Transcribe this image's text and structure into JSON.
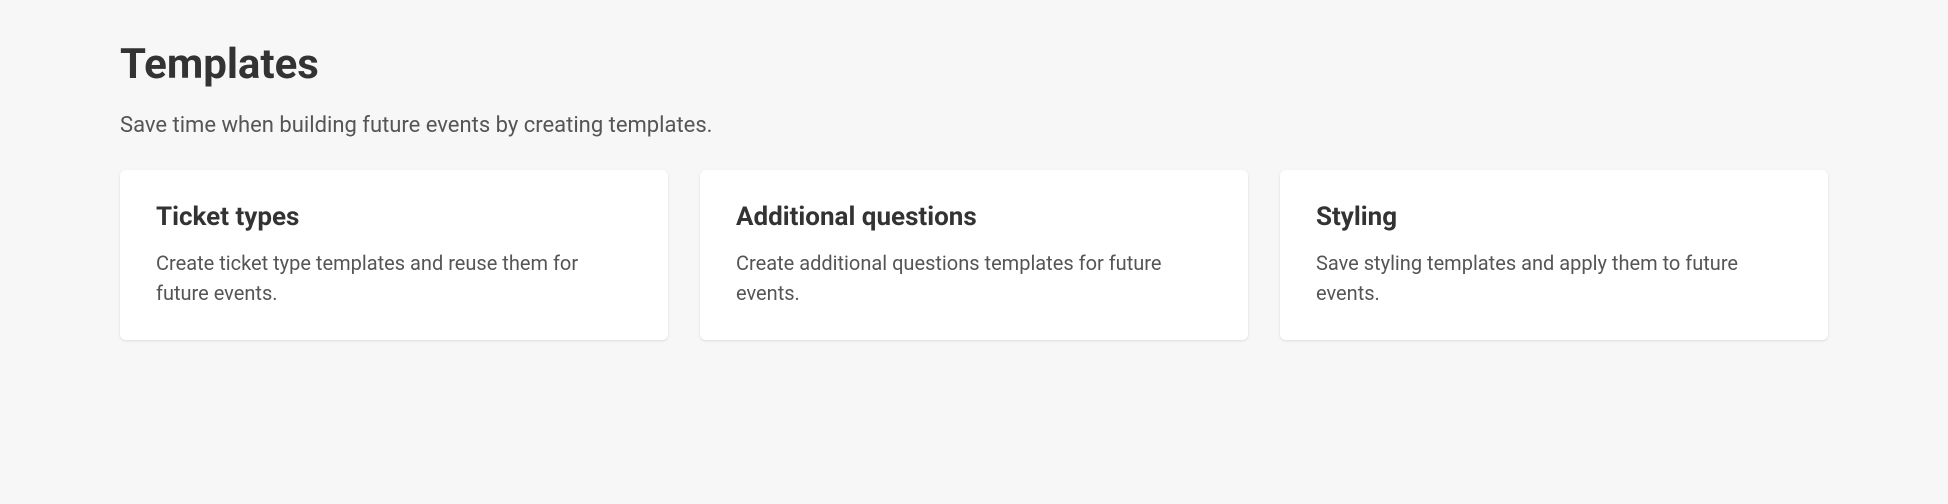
{
  "header": {
    "title": "Templates",
    "subtitle": "Save time when building future events by creating templates."
  },
  "cards": [
    {
      "title": "Ticket types",
      "description": "Create ticket type templates and reuse them for future events."
    },
    {
      "title": "Additional questions",
      "description": "Create additional questions templates for future events."
    },
    {
      "title": "Styling",
      "description": "Save styling templates and apply them to future events."
    }
  ]
}
